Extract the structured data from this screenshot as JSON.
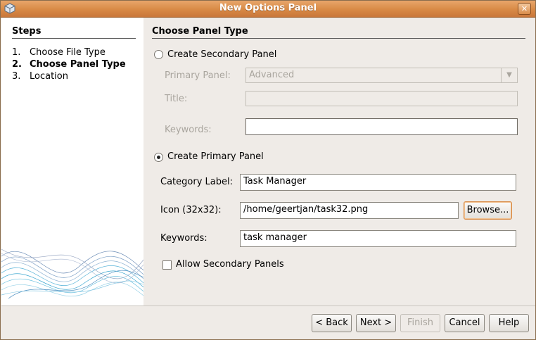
{
  "window": {
    "title": "New Options Panel"
  },
  "steps": {
    "heading": "Steps",
    "items": [
      {
        "num": "1.",
        "label": "Choose File Type"
      },
      {
        "num": "2.",
        "label": "Choose Panel Type"
      },
      {
        "num": "3.",
        "label": "Location"
      }
    ]
  },
  "panel": {
    "heading": "Choose Panel Type",
    "secondary": {
      "radio_label": "Create Secondary Panel",
      "primary_panel_label": "Primary Panel:",
      "primary_panel_value": "Advanced",
      "title_label": "Title:",
      "title_value": "",
      "keywords_label": "Keywords:",
      "keywords_value": ""
    },
    "primary": {
      "radio_label": "Create Primary Panel",
      "category_label": "Category Label:",
      "category_value": "Task Manager",
      "icon_label": "Icon (32x32):",
      "icon_value": "/home/geertjan/task32.png",
      "browse_label": "Browse...",
      "keywords_label": "Keywords:",
      "keywords_value": "task manager",
      "allow_secondary_label": "Allow Secondary Panels"
    }
  },
  "buttons": {
    "back": "< Back",
    "next": "Next >",
    "finish": "Finish",
    "cancel": "Cancel",
    "help": "Help"
  }
}
